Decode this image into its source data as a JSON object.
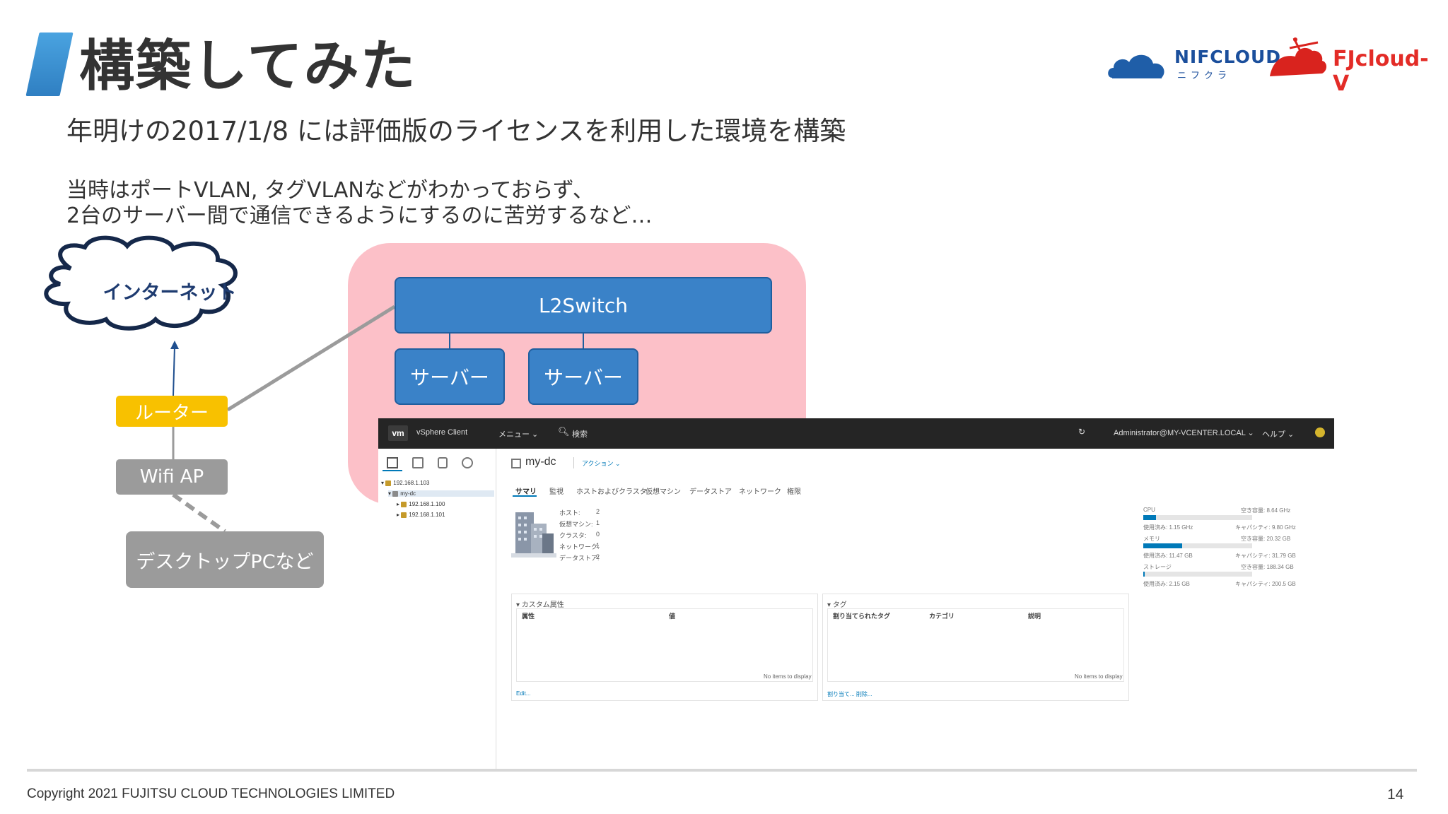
{
  "slide": {
    "title": "構築してみた",
    "subtitle": "年明けの2017/1/8 には評価版のライセンスを利用した環境を構築",
    "note_line1": "当時はポートVLAN, タグVLANなどがわかっておらず、",
    "note_line2": "2台のサーバー間で通信できるようにするのに苦労するなど…",
    "copyright": "Copyright 2021 FUJITSU CLOUD TECHNOLOGIES LIMITED",
    "page_number": "14"
  },
  "logos": {
    "nifcloud": "NIFCLOUD",
    "nifcloud_kana": "ニフクラ",
    "fjcloud": "FJcloud-V"
  },
  "colors": {
    "accent_blue": "#3a82c8",
    "pink": "#fcc0c8",
    "router_yellow": "#f8c100",
    "gray_box": "#9b9b9b",
    "fj_red": "#e32c27"
  },
  "diagram": {
    "cloud": "インターネット",
    "router": "ルーター",
    "wifi": "Wifi AP",
    "desktop": "デスクトップPCなど",
    "switch": "L2Switch",
    "server1": "サーバー",
    "server2": "サーバー"
  },
  "vsphere": {
    "logo": "vm",
    "app_name": "vSphere Client",
    "menu": "メニュー ⌄",
    "search": "検索",
    "user": "Administrator@MY-VCENTER.LOCAL ⌄",
    "help": "ヘルプ ⌄",
    "icons": [
      "hosts-clusters-icon",
      "vms-templates-icon",
      "storage-icon",
      "networking-icon",
      "refresh-icon",
      "search-icon",
      "status-icon",
      "datacenter-icon"
    ],
    "tree": [
      "192.168.1.103",
      "my-dc",
      "192.168.1.100",
      "192.168.1.101"
    ],
    "dc_name": "my-dc",
    "actions": "アクション ⌄",
    "tabs": [
      "サマリ",
      "監視",
      "ホストおよびクラスタ",
      "仮想マシン",
      "データストア",
      "ネットワーク",
      "権限"
    ],
    "summary": [
      {
        "label": "ホスト:",
        "value": "2"
      },
      {
        "label": "仮想マシン:",
        "value": "1"
      },
      {
        "label": "クラスタ:",
        "value": "0"
      },
      {
        "label": "ネットワーク:",
        "value": "1"
      },
      {
        "label": "データストア:",
        "value": "2"
      }
    ],
    "resources": [
      {
        "name": "CPU",
        "free": "空き容量: 8.64 GHz",
        "used": "使用済み: 1.15 GHz",
        "cap": "キャパシティ: 9.80 GHz",
        "fill": 0.12
      },
      {
        "name": "メモリ",
        "free": "空き容量: 20.32 GB",
        "used": "使用済み: 11.47 GB",
        "cap": "キャパシティ: 31.79 GB",
        "fill": 0.36
      },
      {
        "name": "ストレージ",
        "free": "空き容量: 188.34 GB",
        "used": "使用済み: 2.15 GB",
        "cap": "キャパシティ: 200.5 GB",
        "fill": 0.01
      }
    ],
    "custom_attr": {
      "title": "▾ カスタム属性",
      "col1": "属性",
      "col2": "値",
      "empty": "No items to display",
      "edit": "Edit..."
    },
    "tags": {
      "title": "▾ タグ",
      "col1": "割り当てられたタグ",
      "col2": "カテゴリ",
      "col3": "説明",
      "empty": "No items to display",
      "assign": "割り当て...  削除..."
    }
  }
}
